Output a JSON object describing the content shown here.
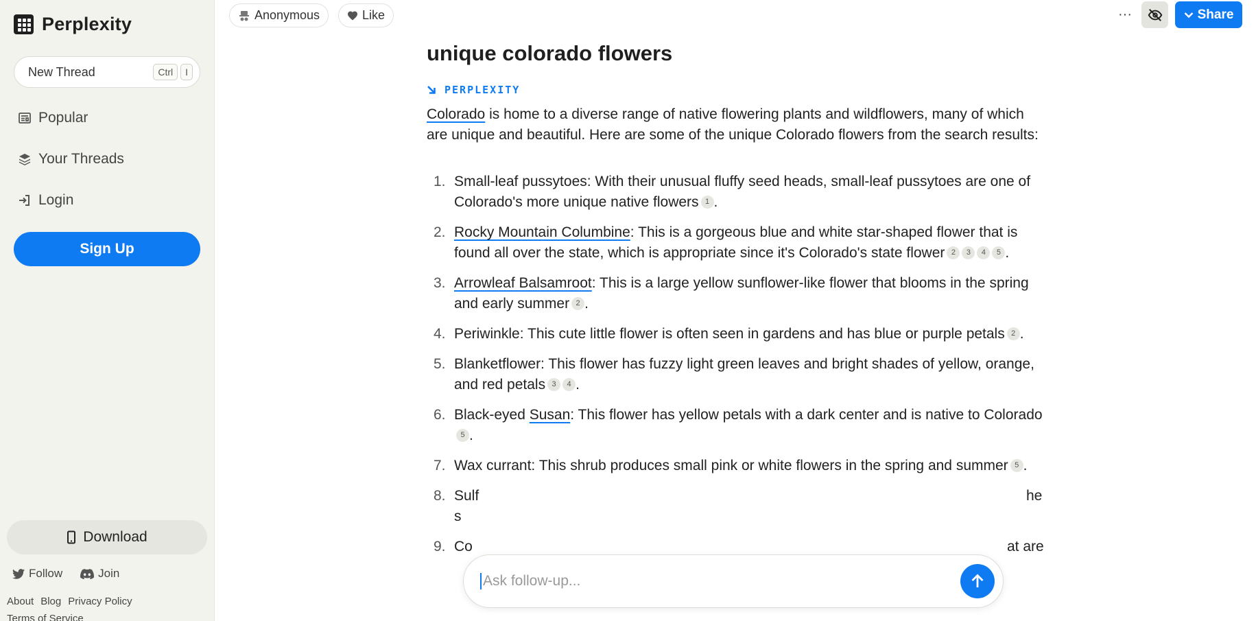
{
  "sidebar": {
    "brand": "Perplexity",
    "new_thread": {
      "label": "New Thread",
      "shortcut": [
        "Ctrl",
        "I"
      ]
    },
    "items": [
      {
        "label": "Popular",
        "icon": "newspaper-icon"
      },
      {
        "label": "Your Threads",
        "icon": "stack-icon"
      },
      {
        "label": "Login",
        "icon": "login-icon"
      }
    ],
    "signup": "Sign Up",
    "download": "Download",
    "social": {
      "follow": "Follow",
      "join": "Join"
    },
    "footer": {
      "about": "About",
      "blog": "Blog",
      "privacy": "Privacy Policy",
      "terms": "Terms of Service"
    }
  },
  "topbar": {
    "user": "Anonymous",
    "like": "Like",
    "more": "···",
    "share": "Share"
  },
  "main": {
    "title": "unique colorado flowers",
    "source_label": "PERPLEXITY",
    "intro": {
      "link": "Colorado",
      "text": " is home to a diverse range of native flowering plants and wildflowers, many of which are unique and beautiful. Here are some of the unique Colorado flowers from the search results:"
    },
    "list": [
      {
        "num": "1.",
        "before": "Small-leaf pussytoes: With their unusual fluffy seed heads, small-leaf pussytoes are one of Colorado's more unique native flowers",
        "cites": [
          "1"
        ]
      },
      {
        "num": "2.",
        "link": "Rocky Mountain Columbine",
        "after": ": This is a gorgeous blue and white star-shaped flower that is found all over the state, which is appropriate since it's Colorado's state flower",
        "cites": [
          "2",
          "3",
          "4",
          "5"
        ]
      },
      {
        "num": "3.",
        "link": "Arrowleaf Balsamroot",
        "after": ": This is a large yellow sunflower-like flower that blooms in the spring and early summer",
        "cites": [
          "2"
        ]
      },
      {
        "num": "4.",
        "before": "Periwinkle: This cute little flower is often seen in gardens and has blue or purple petals",
        "cites": [
          "2"
        ]
      },
      {
        "num": "5.",
        "before": "Blanketflower: This flower has fuzzy light green leaves and bright shades of yellow, orange, and red petals",
        "cites": [
          "3",
          "4"
        ]
      },
      {
        "num": "6.",
        "before": "Black-eyed ",
        "link": "Susan",
        "after": ": This flower has yellow petals with a dark center and is native to Colorado",
        "cites": [
          "5"
        ]
      },
      {
        "num": "7.",
        "before": "Wax currant: This shrub produces small pink or white flowers in the spring and summer",
        "cites": [
          "5"
        ]
      },
      {
        "num": "8.",
        "before": "Sulf",
        "line2": "s",
        "tail": "he"
      },
      {
        "num": "9.",
        "before": "Co",
        "tail": "at are"
      }
    ]
  },
  "followup": {
    "placeholder": "Ask follow-up..."
  },
  "colors": {
    "accent": "#0f7bf2",
    "sidebar_bg": "#f3f3ee"
  }
}
